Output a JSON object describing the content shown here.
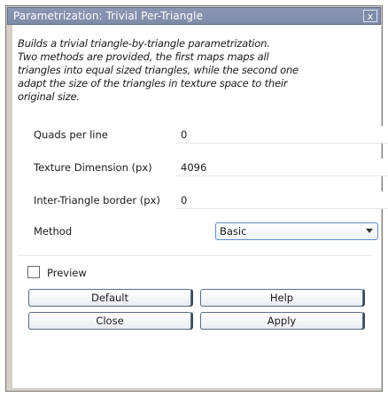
{
  "window": {
    "title": "Parametrization: Trivial Per-Triangle",
    "close_glyph": "x"
  },
  "description": [
    "Builds a trivial triangle-by-triangle parametrization.",
    "Two methods are provided, the first maps maps all",
    "triangles into equal sized triangles, while the second one",
    "adapt the size of the triangles in texture space to their",
    "original size."
  ],
  "params": [
    {
      "label": "Quads per line",
      "value": "0"
    },
    {
      "label": "Texture Dimension (px)",
      "value": "4096"
    },
    {
      "label": "Inter-Triangle border (px)",
      "value": "0"
    }
  ],
  "method": {
    "label": "Method",
    "selected": "Basic"
  },
  "preview": {
    "label": "Preview",
    "checked": false
  },
  "buttons": {
    "default": "Default",
    "help": "Help",
    "close": "Close",
    "apply": "Apply"
  }
}
